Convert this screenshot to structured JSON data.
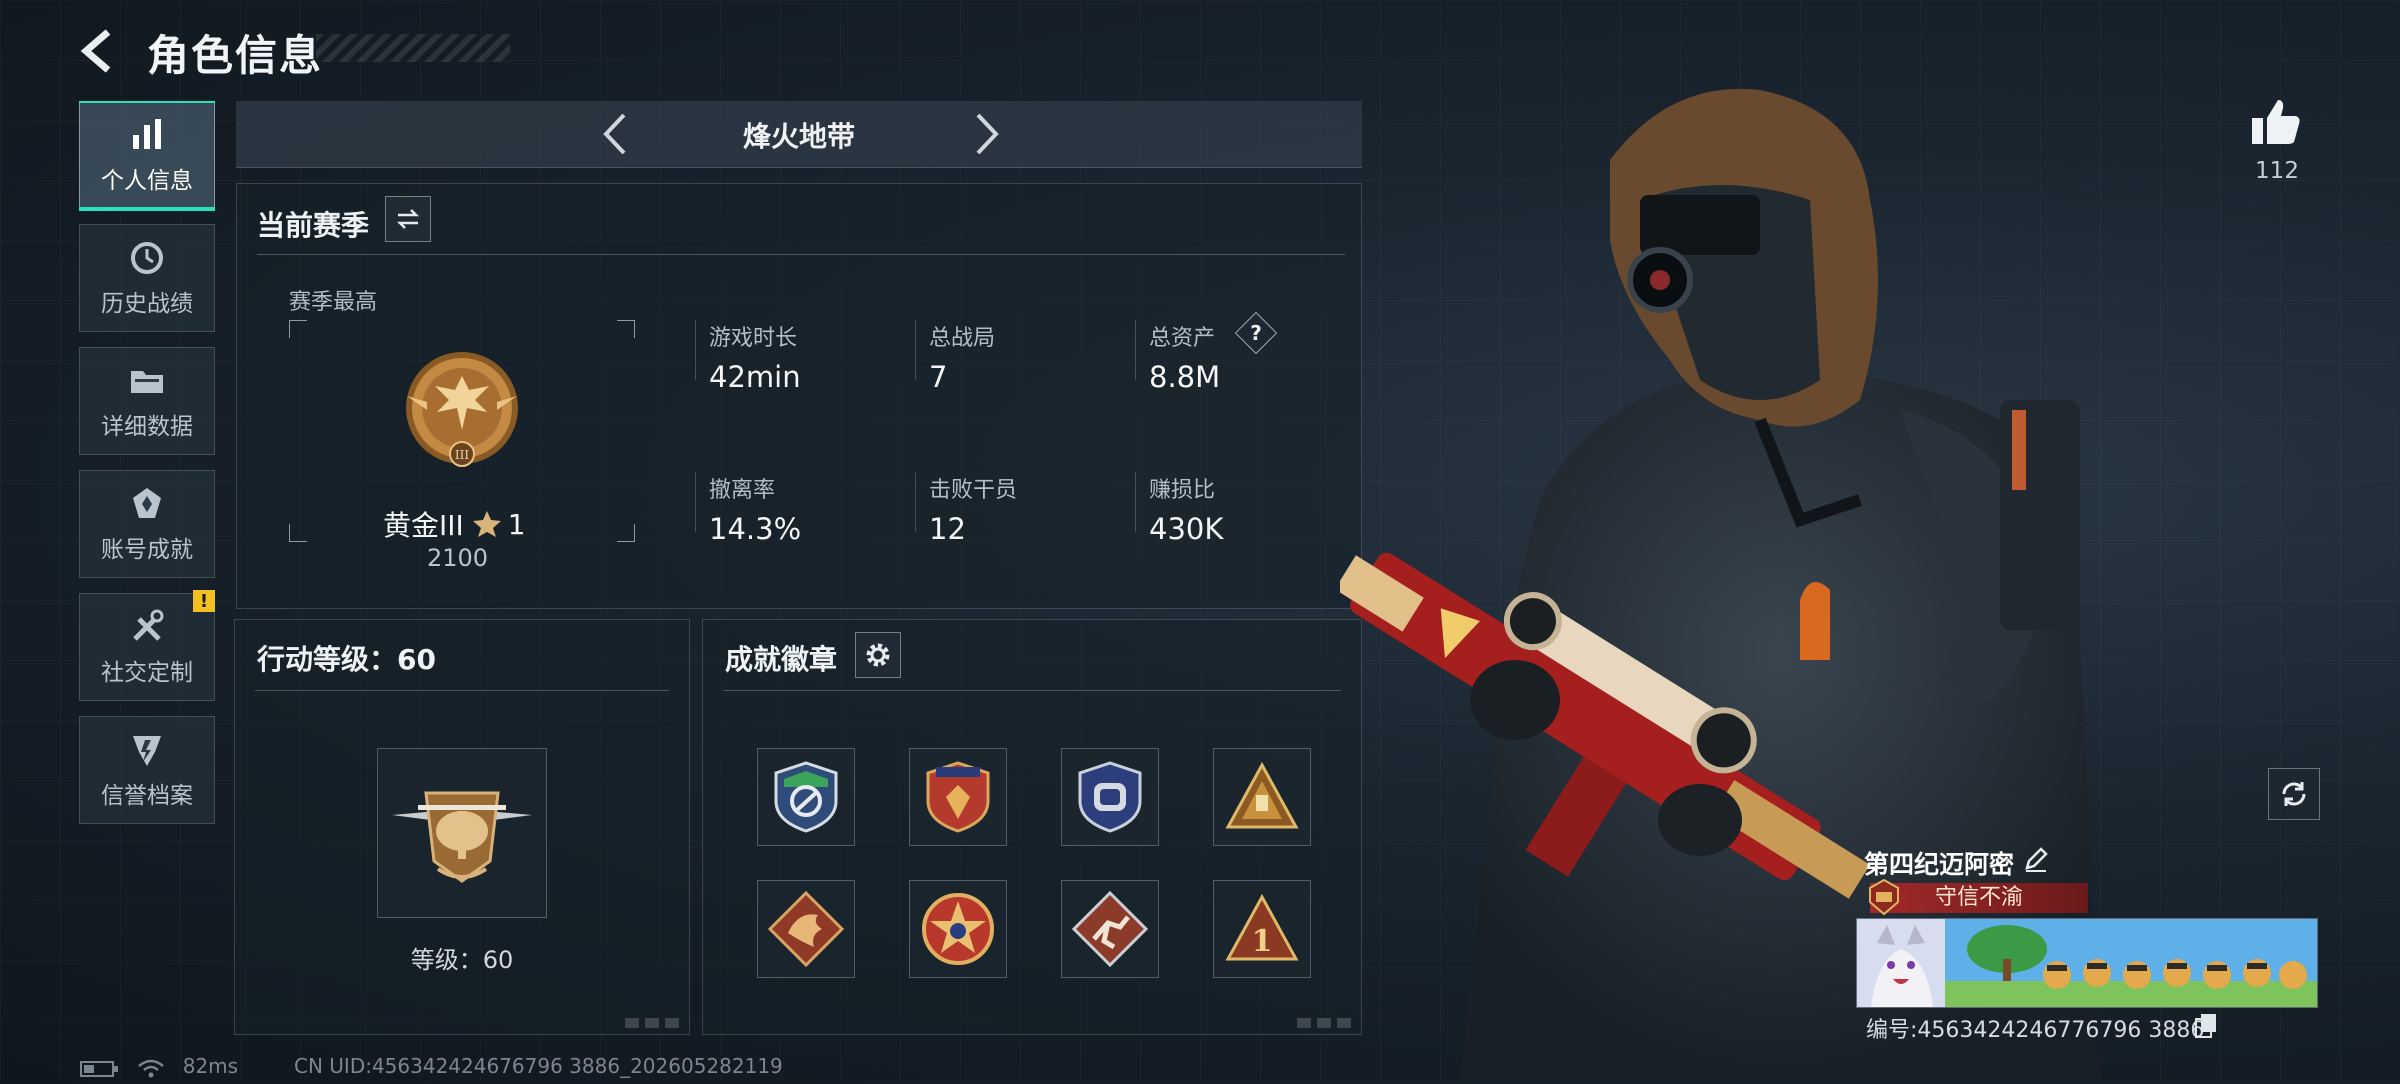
{
  "header": {
    "title": "角色信息"
  },
  "nav": {
    "items": [
      {
        "label": "个人信息",
        "icon": "bar-chart-icon",
        "active": true
      },
      {
        "label": "历史战绩",
        "icon": "history-clock-icon"
      },
      {
        "label": "详细数据",
        "icon": "folder-icon"
      },
      {
        "label": "账号成就",
        "icon": "achievement-icon"
      },
      {
        "label": "社交定制",
        "icon": "wrench-tools-icon",
        "alert": "!"
      },
      {
        "label": "信誉档案",
        "icon": "credit-shield-icon"
      }
    ]
  },
  "mode": {
    "title": "烽火地带"
  },
  "season": {
    "title": "当前赛季",
    "best_label": "赛季最高",
    "rank_name": "黄金III",
    "rank_stars": "1",
    "rank_points": "2100",
    "stats": [
      {
        "label": "游戏时长",
        "value": "42min"
      },
      {
        "label": "总战局",
        "value": "7"
      },
      {
        "label": "总资产",
        "value": "8.8M",
        "help": "?"
      },
      {
        "label": "撤离率",
        "value": "14.3%"
      },
      {
        "label": "击败干员",
        "value": "12"
      },
      {
        "label": "赚损比",
        "value": "430K"
      }
    ]
  },
  "action_level": {
    "title": "行动等级：60",
    "level_text": "等级：60"
  },
  "achievements": {
    "title": "成就徽章",
    "badges": [
      "strategy-badge",
      "red-shield-badge",
      "blue-shield-badge",
      "gold-triangle-badge",
      "dragon-badge",
      "star-emblem-badge",
      "runner-badge",
      "rank-one-badge"
    ]
  },
  "character": {
    "likes": "112",
    "name": "第四纪迈阿密",
    "title_tag": "守信不渝",
    "id_text": "编号:4563424246776796 3886"
  },
  "status": {
    "ping": "82ms",
    "uid": "CN UID:456342424676796 3886_202605282119"
  },
  "colors": {
    "accent": "#26e3b8",
    "alert": "#f2c021",
    "title_tag": "#a82828"
  }
}
